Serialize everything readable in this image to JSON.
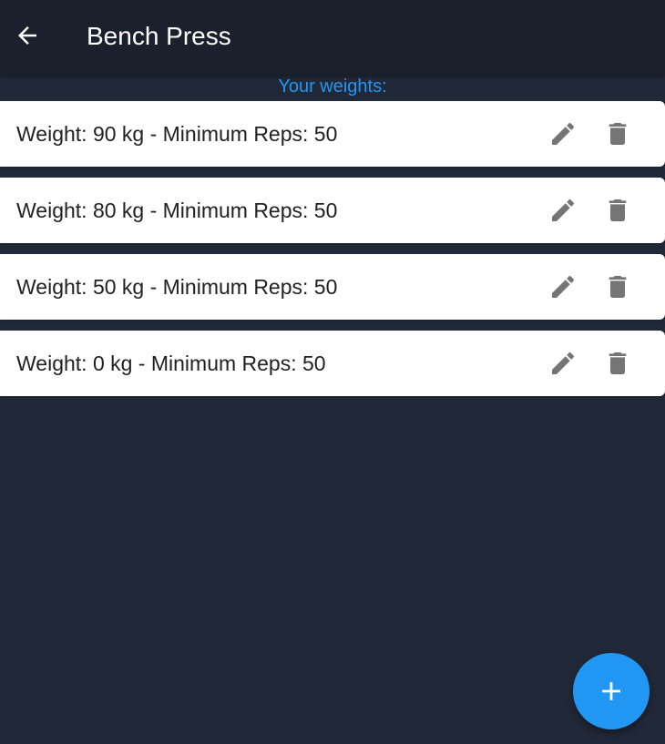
{
  "appbar": {
    "title": "Bench Press",
    "back_icon": "arrow-back-icon"
  },
  "section": {
    "label": "Your weights:"
  },
  "weights": [
    {
      "text": "Weight: 90 kg - Minimum Reps: 50"
    },
    {
      "text": "Weight: 80 kg - Minimum Reps: 50"
    },
    {
      "text": "Weight: 50 kg - Minimum Reps: 50"
    },
    {
      "text": "Weight: 0 kg - Minimum Reps: 50"
    }
  ],
  "icons": {
    "edit": "pencil-icon",
    "delete": "trash-icon",
    "add": "plus-icon"
  },
  "colors": {
    "background": "#212837",
    "appbar": "#1a202c",
    "accent": "#2196f3",
    "card": "#ffffff",
    "icon_gray": "#757575"
  }
}
